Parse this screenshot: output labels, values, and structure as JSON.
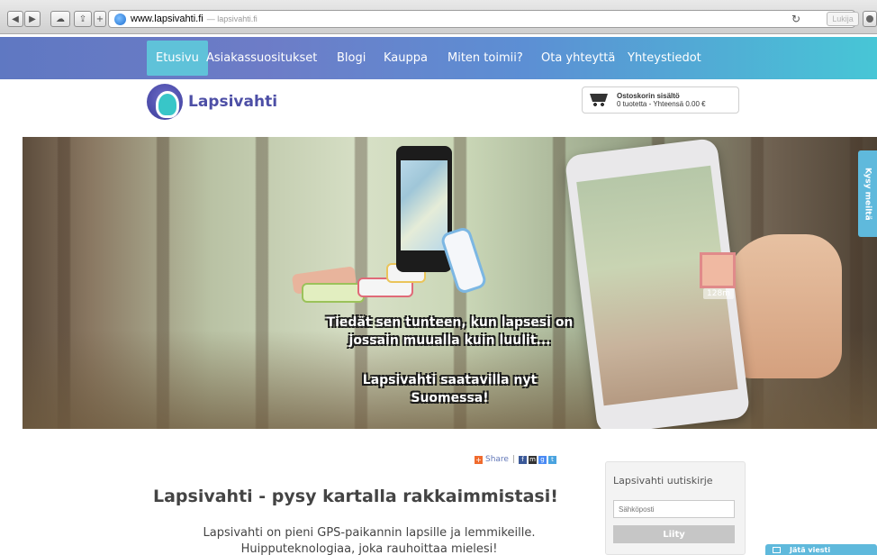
{
  "browser": {
    "url_host": "www.lapsivahti.fi",
    "url_title": "— lapsivahti.fi",
    "reader_label": "Lukija"
  },
  "nav": {
    "items": [
      "Etusivu",
      "Asiakassuositukset",
      "Blogi",
      "Kauppa",
      "Miten toimii?",
      "Ota yhteyttä",
      "Yhteystiedot"
    ],
    "active_index": 0,
    "colors": {
      "gradient_start": "#5f78c2",
      "gradient_end": "#47c6d6",
      "active_bg": "#5fc2d9"
    }
  },
  "header": {
    "logo_text": "Lapsivahti",
    "cart": {
      "title": "Ostoskorin sisältö",
      "info": "0  tuotetta - Yhteensä 0.00 €"
    }
  },
  "hero": {
    "taglines": [
      "Tiedät sen tunteen, kun lapsesi on",
      "jossain muualla kuin luulit...",
      "Lapsivahti saatavilla nyt",
      "Suomessa!"
    ],
    "distance_tag": "128m",
    "gps_label": "trax"
  },
  "side_tab": {
    "label": "Kysy meiltä"
  },
  "share": {
    "label": "Share",
    "separator": "|",
    "icons": [
      "facebook-icon",
      "myspace-icon",
      "google-plus-icon",
      "twitter-icon"
    ]
  },
  "main": {
    "title": "Lapsivahti - pysy kartalla rakkaimmistasi!",
    "lead_line1": "Lapsivahti on pieni GPS-paikannin lapsille ja lemmikeille.",
    "lead_line2": "Huipputeknologiaa, joka rauhoittaa mielesi!"
  },
  "newsletter": {
    "title": "Lapsivahti uutiskirje",
    "email_placeholder": "Sähköposti",
    "join_label": "Liity"
  },
  "chat": {
    "label": "Jätä viesti"
  }
}
